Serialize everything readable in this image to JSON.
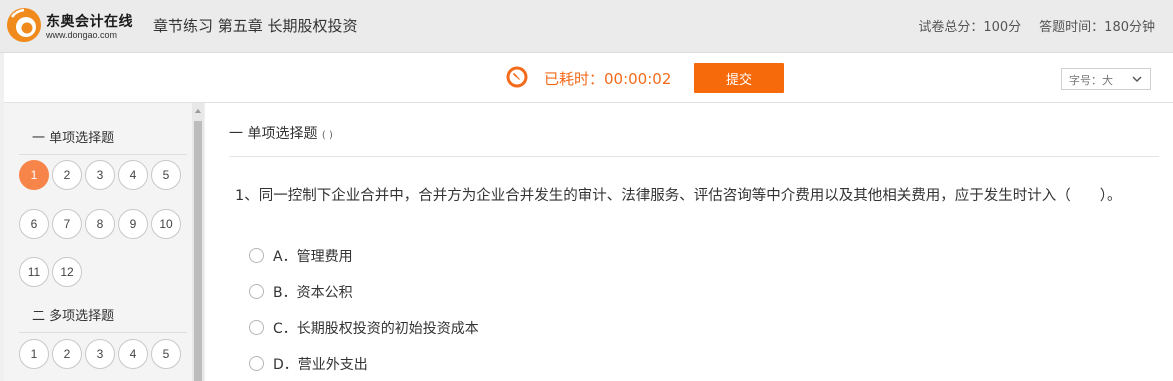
{
  "brand": {
    "name": "东奥会计在线",
    "url": "www.dongao.com",
    "accent": "#f36a1a"
  },
  "header": {
    "title": "章节练习 第五章 长期股权投资",
    "total_score": "试卷总分：100分",
    "time_limit": "答题时间：180分钟"
  },
  "toolbar": {
    "icon": "clock-icon",
    "elapsed": "已耗时：00:00:02",
    "submit_label": "提交",
    "font_size": "字号：大"
  },
  "sidebar": {
    "sections": [
      {
        "title": "一 单项选择题",
        "numbers": [
          "1",
          "2",
          "3",
          "4",
          "5",
          "6",
          "7",
          "8",
          "9",
          "10",
          "11",
          "12"
        ],
        "active": "1"
      },
      {
        "title": "二 多项选择题",
        "numbers": [
          "1",
          "2",
          "3",
          "4",
          "5"
        ]
      }
    ]
  },
  "main": {
    "section_title": "一 单项选择题",
    "section_note": "( )",
    "question": {
      "text": "1、同一控制下企业合并中，合并方为企业合并发生的审计、法律服务、评估咨询等中介费用以及其他相关费用，应于发生时计入（　　）。",
      "options": [
        "A．管理费用",
        "B．资本公积",
        "C．长期股权投资的初始投资成本",
        "D．营业外支出"
      ]
    }
  }
}
